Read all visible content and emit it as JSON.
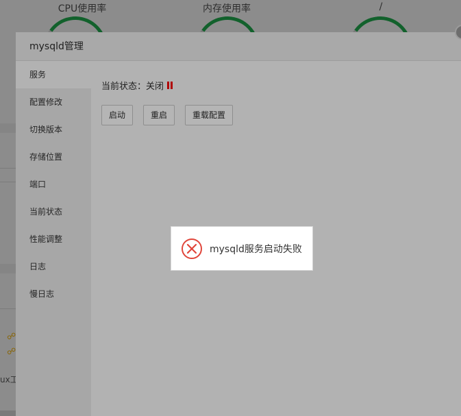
{
  "background": {
    "gauges": [
      {
        "label": "CPU使用率"
      },
      {
        "label": "内存使用率"
      },
      {
        "label": "/"
      }
    ],
    "fragment_text": "ux工"
  },
  "modal": {
    "title": "mysqld管理",
    "sidebar": [
      {
        "label": "服务",
        "active": true
      },
      {
        "label": "配置修改"
      },
      {
        "label": "切换版本"
      },
      {
        "label": "存储位置"
      },
      {
        "label": "端口"
      },
      {
        "label": "当前状态"
      },
      {
        "label": "性能调整"
      },
      {
        "label": "日志"
      },
      {
        "label": "慢日志"
      }
    ],
    "status_label": "当前状态：关闭",
    "buttons": {
      "start": "启动",
      "restart": "重启",
      "reload": "重载配置"
    }
  },
  "toast": {
    "icon": "error-circle-x-icon",
    "message": "mysqld服务启动失败",
    "icon_color": "#e0453a"
  },
  "colors": {
    "status_stopped": "#b00000",
    "gauge_green": "#12612c"
  }
}
